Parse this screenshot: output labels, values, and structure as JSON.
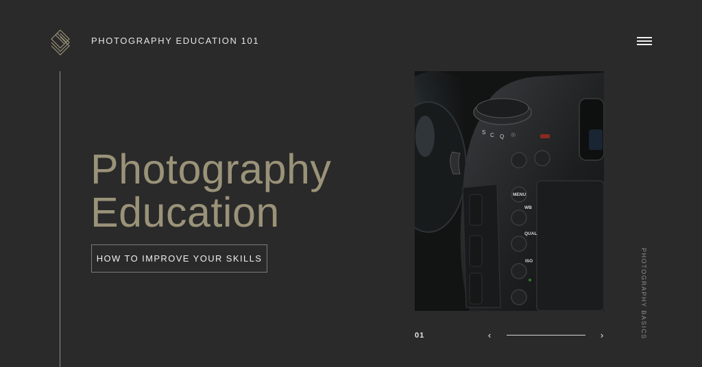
{
  "header": {
    "site_title": "PHOTOGRAPHY EDUCATION 101",
    "logo_icon": "diamond-stack-logo",
    "menu_icon": "hamburger-icon"
  },
  "hero": {
    "heading_line_1": "Photography",
    "heading_line_2": "Education",
    "cta_label": "HOW TO IMPROVE YOUR SKILLS"
  },
  "slider": {
    "counter": "01",
    "prev_icon": "‹",
    "next_icon": "›",
    "progress": 1.0,
    "image_description_icon": "camera-photo"
  },
  "side_label": "PHOTOGRAPHY BASICS",
  "colors": {
    "background": "#2a2a2a",
    "accent": "#9a9379",
    "text": "#e6e6e6"
  }
}
